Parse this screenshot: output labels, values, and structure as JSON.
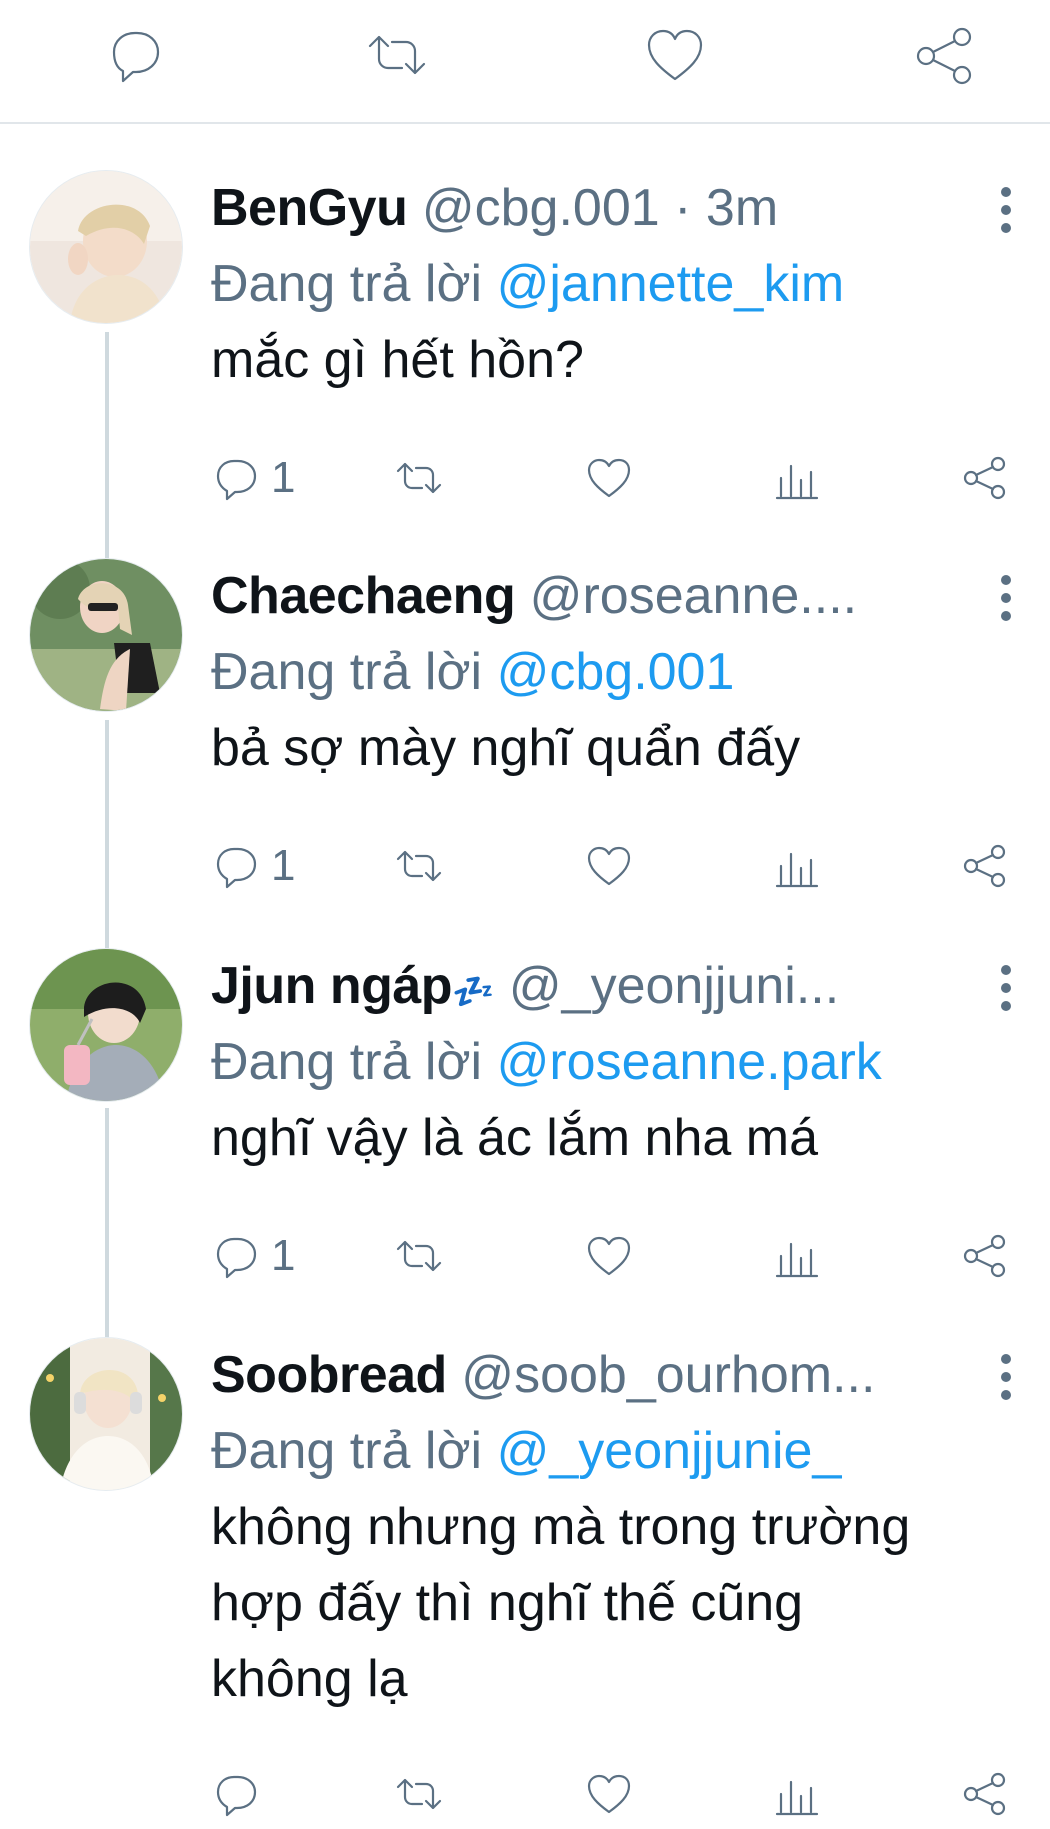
{
  "top_actions": {
    "reply_icon": "reply-icon",
    "retweet_icon": "retweet-icon",
    "like_icon": "heart-icon",
    "share_icon": "share-icon"
  },
  "replies": [
    {
      "display_name": "BenGyu",
      "handle": "@cbg.001",
      "separator": "·",
      "time": "3m",
      "replying_prefix": "Đang trả lời",
      "replying_to": "@jannette_kim",
      "text": "mắc gì hết hồn?",
      "reply_count": "1"
    },
    {
      "display_name": "Chaechaeng",
      "handle": "@roseanne....",
      "replying_prefix": "Đang trả lời",
      "replying_to": "@cbg.001",
      "text": "bả sợ mày nghĩ quẩn đấy",
      "reply_count": "1"
    },
    {
      "display_name": "Jjun ngáp",
      "name_emoji": "💤",
      "handle": "@_yeonjjuni...",
      "replying_prefix": "Đang trả lời",
      "replying_to": "@roseanne.park",
      "text": "nghĩ vậy là ác lắm nha má",
      "reply_count": "1"
    },
    {
      "display_name": "Soobread",
      "handle": "@soob_ourhom...",
      "replying_prefix": "Đang trả lời",
      "replying_to": "@_yeonjjunie_",
      "text": "không nhưng mà trong trường hợp đấy thì nghĩ thế cũng không lạ",
      "reply_count": ""
    }
  ],
  "colors": {
    "icon_gray": "#5b7083",
    "mention_blue": "#1d9bf0",
    "thread_line": "#cfd9de"
  }
}
